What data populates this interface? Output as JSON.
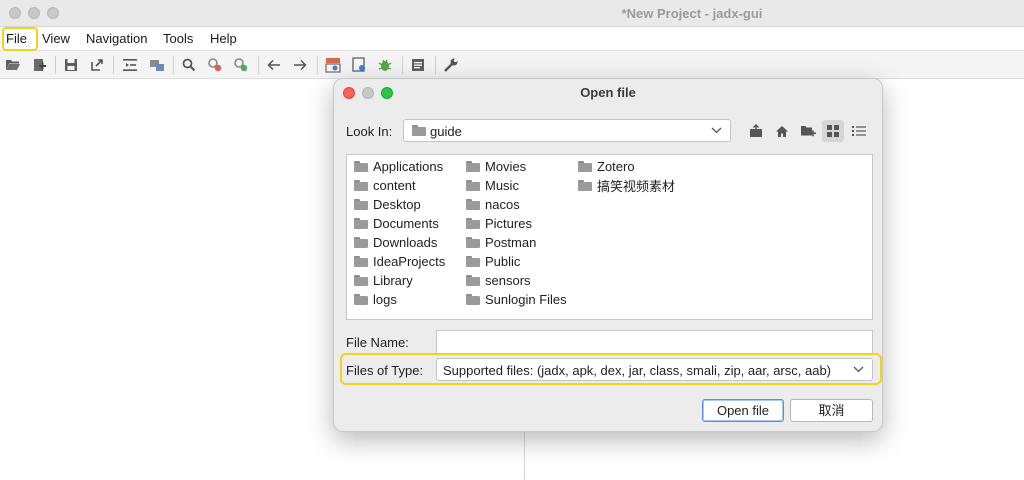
{
  "window": {
    "title": "*New Project - jadx-gui"
  },
  "menubar": {
    "items": [
      "File",
      "View",
      "Navigation",
      "Tools",
      "Help"
    ]
  },
  "toolbar": {
    "icons": [
      "open-folder-icon",
      "add-file-icon",
      "save-icon",
      "export-icon",
      "sync-tree-icon",
      "flatten-packages-icon",
      "search-icon",
      "find-class-icon",
      "find-usage-icon",
      "back-icon",
      "forward-icon",
      "deobfuscation-icon",
      "quark-icon",
      "debugger-icon",
      "log-viewer-icon",
      "preferences-icon"
    ]
  },
  "dialog": {
    "title": "Open file",
    "look_in_label": "Look In:",
    "look_in_value": "guide",
    "files": {
      "col1": [
        "Applications",
        "content",
        "Desktop",
        "Documents",
        "Downloads",
        "IdeaProjects",
        "Library",
        "logs"
      ],
      "col2": [
        "Movies",
        "Music",
        "nacos",
        "Pictures",
        "Postman",
        "Public",
        "sensors",
        "Sunlogin Files"
      ],
      "col3": [
        "Zotero",
        "搞笑视频素材"
      ]
    },
    "file_name_label": "File Name:",
    "file_name_value": "",
    "files_of_type_label": "Files of Type:",
    "files_of_type_value": "Supported files: (jadx, apk, dex, jar, class, smali, zip, aar, arsc, aab)",
    "open_button": "Open file",
    "cancel_button": "取消"
  },
  "colors": {
    "highlight": "#f3d21b",
    "close": "#fe5f57",
    "minimize": "#febc2e",
    "maximize": "#28c840"
  }
}
